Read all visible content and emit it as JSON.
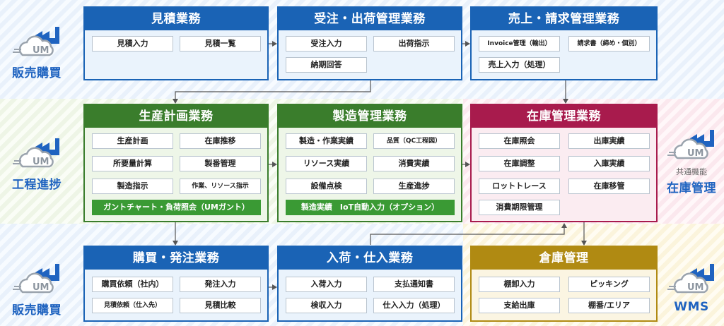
{
  "left_labels": {
    "top": "販売購買",
    "mid": "工程進捗",
    "bottom": "販売購買"
  },
  "right_labels": {
    "mid_sub": "共通機能",
    "mid": "在庫管理",
    "bottom": "WMS"
  },
  "logo_text": "UM",
  "panels": {
    "estimate": {
      "title": "見積業務",
      "items": [
        "見積入力",
        "見積一覧"
      ]
    },
    "order": {
      "title": "受注・出荷管理業務",
      "items": [
        "受注入力",
        "出荷指示",
        "納期回答"
      ]
    },
    "sales": {
      "title": "売上・請求管理業務",
      "items": [
        "Invoice管理（輸出）",
        "請求書（締め・個別）",
        "売上入力（処理）"
      ]
    },
    "plan": {
      "title": "生産計画業務",
      "items": [
        "生産計画",
        "在庫推移",
        "所要量計算",
        "製番管理",
        "製造指示",
        "作業、リソース指示"
      ],
      "bar": "ガントチャート・負荷照会（UMガント）"
    },
    "mfg": {
      "title": "製造管理業務",
      "items": [
        "製造・作業実績",
        "品質（QC工程図）",
        "リソース実績",
        "消費実績",
        "設備点検",
        "生産進捗"
      ],
      "bar": "製造実績　IoT自動入力（オプション）"
    },
    "inventory": {
      "title": "在庫管理業務",
      "items": [
        "在庫照会",
        "出庫実績",
        "在庫調整",
        "入庫実績",
        "ロットトレース",
        "在庫移管",
        "消費期限管理"
      ]
    },
    "purchase": {
      "title": "購買・発注業務",
      "items": [
        "購買依頼（社内）",
        "発注入力",
        "見積依頼（仕入先）",
        "見積比較"
      ]
    },
    "receiving": {
      "title": "入荷・仕入業務",
      "items": [
        "入荷入力",
        "支払通知書",
        "検収入力",
        "仕入入力（処理）"
      ]
    },
    "warehouse": {
      "title": "倉庫管理",
      "items": [
        "棚卸入力",
        "ピッキング",
        "支給出庫",
        "棚番/エリア"
      ]
    }
  },
  "colors": {
    "blue": "#1a63b5",
    "green": "#3a7d2c",
    "pink": "#a81b4d",
    "gold": "#b08a12",
    "label_blue": "#1f63c0"
  },
  "icons": [
    "factory-cloud-icon"
  ]
}
